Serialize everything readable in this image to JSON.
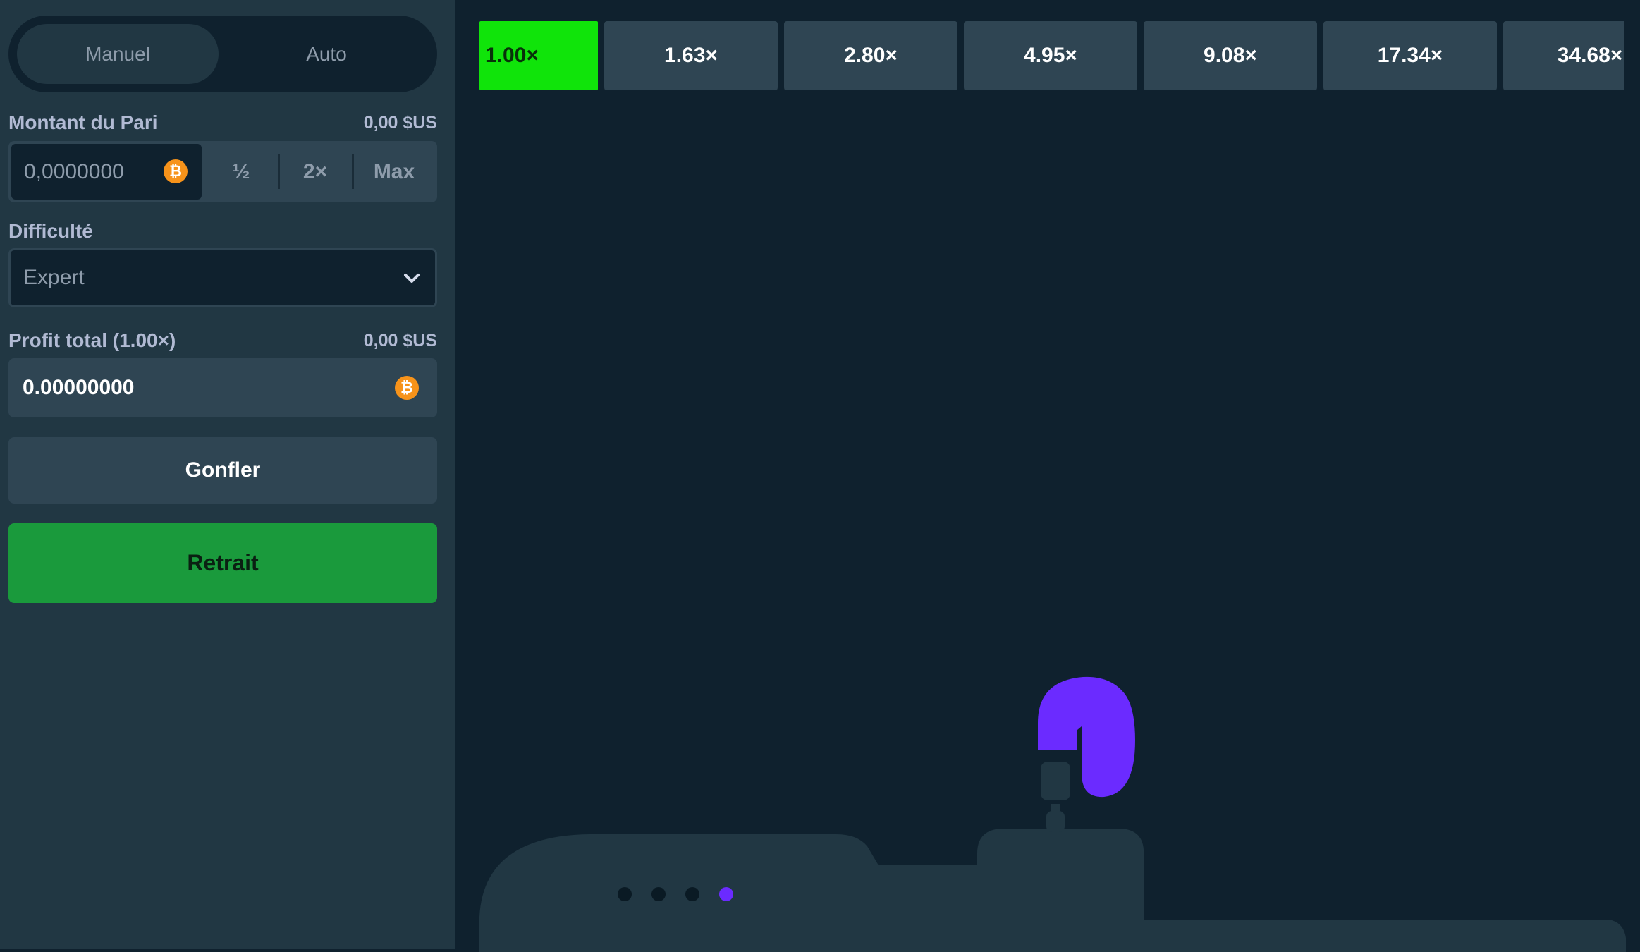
{
  "sidebar": {
    "mode_tabs": [
      {
        "label": "Manuel",
        "active": true
      },
      {
        "label": "Auto",
        "active": false
      }
    ],
    "bet": {
      "label": "Montant du Pari",
      "usd_value": "0,00 $US",
      "amount": "0,0000000",
      "coin_icon": "bitcoin-icon",
      "half_label": "½",
      "double_label": "2×",
      "max_label": "Max"
    },
    "difficulty": {
      "label": "Difficulté",
      "selected": "Expert",
      "chevron_icon": "chevron-down-icon"
    },
    "profit": {
      "label": "Profit total (1.00×)",
      "usd_value": "0,00 $US",
      "amount": "0.00000000"
    },
    "inflate_label": "Gonfler",
    "cashout_label": "Retrait"
  },
  "game": {
    "multipliers": [
      "1.00×",
      "1.63×",
      "2.80×",
      "4.95×",
      "9.08×",
      "17.34×",
      "34.68×"
    ],
    "active_multiplier_index": 0,
    "progress_dots": {
      "count": 4,
      "active_index": 3
    }
  },
  "colors": {
    "sidebar_bg": "#213743",
    "game_bg": "#0f212e",
    "panel": "#2f4553",
    "active_multiplier": "#10e40a",
    "cashout_button": "#1a9a3c",
    "balloon": "#6b2bff",
    "bitcoin": "#f7931a"
  }
}
